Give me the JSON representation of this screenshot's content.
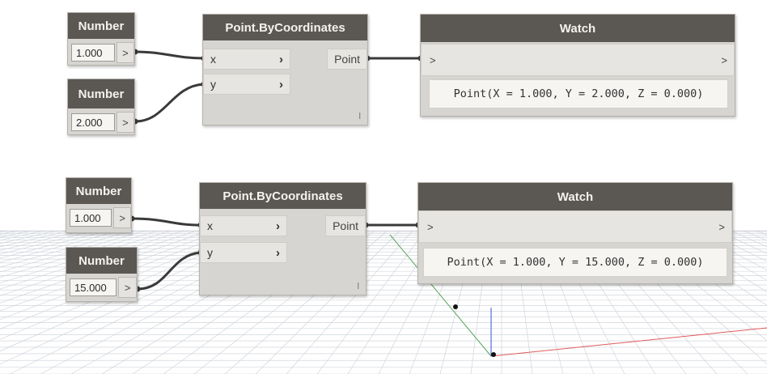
{
  "graph_a": {
    "number_x": {
      "title": "Number",
      "value": "1.000",
      "output_port": ">"
    },
    "number_y": {
      "title": "Number",
      "value": "2.000",
      "output_port": ">"
    },
    "point_node": {
      "title": "Point.ByCoordinates",
      "input_x": "x",
      "input_y": "y",
      "input_chevron": "›",
      "output": "Point",
      "lacing": "l"
    },
    "watch": {
      "title": "Watch",
      "input_port": ">",
      "output_port": ">",
      "value": "Point(X = 1.000, Y = 2.000, Z = 0.000)"
    }
  },
  "graph_b": {
    "number_x": {
      "title": "Number",
      "value": "1.000",
      "output_port": ">"
    },
    "number_y": {
      "title": "Number",
      "value": "15.000",
      "output_port": ">"
    },
    "point_node": {
      "title": "Point.ByCoordinates",
      "input_x": "x",
      "input_y": "y",
      "input_chevron": "›",
      "output": "Point",
      "lacing": "l"
    },
    "watch": {
      "title": "Watch",
      "input_port": ">",
      "output_port": ">",
      "value": "Point(X = 1.000, Y = 15.000, Z = 0.000)"
    }
  },
  "colors": {
    "node_header": "#5b5753",
    "node_body": "#d7d5d1",
    "wire": "#3a3a3a",
    "grid": "#c9cfd6",
    "x_axis": "#e05a5a",
    "y_axis": "#5aa55a",
    "z_axis": "#5a6ee0"
  }
}
